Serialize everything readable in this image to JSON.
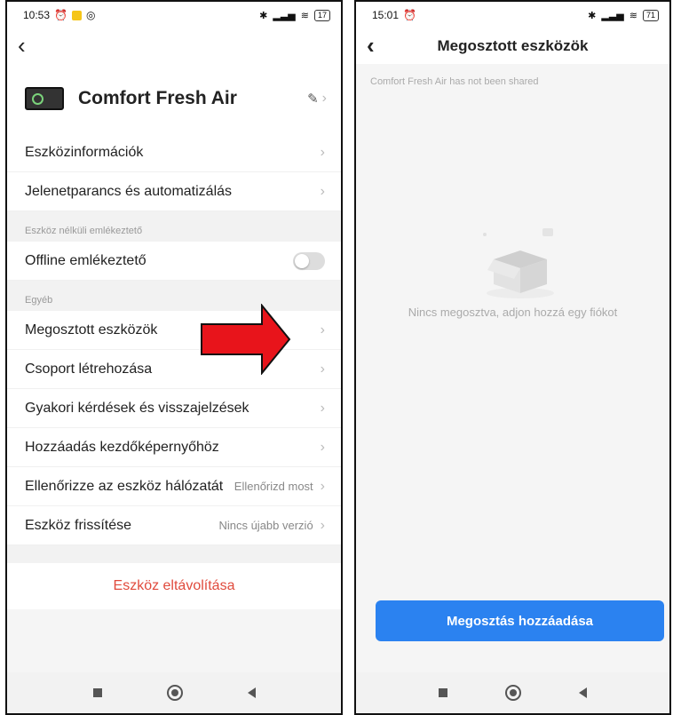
{
  "left": {
    "status": {
      "time": "10:53",
      "battery": "17"
    },
    "device_name": "Comfort  Fresh Air",
    "rows_top": [
      {
        "label": "Eszközinformációk"
      },
      {
        "label": "Jelenetparancs és automatizálás"
      }
    ],
    "section_offline": "Eszköz nélküli emlékeztető",
    "offline_label": "Offline emlékeztető",
    "offline_toggle": "off",
    "section_other": "Egyéb",
    "rows_other": [
      {
        "label": "Megosztott eszközök",
        "value": ""
      },
      {
        "label": "Csoport létrehozása",
        "value": ""
      },
      {
        "label": "Gyakori kérdések és visszajelzések",
        "value": ""
      },
      {
        "label": "Hozzáadás kezdőképernyőhöz",
        "value": ""
      },
      {
        "label": "Ellenőrizze az eszköz hálózatát",
        "value": "Ellenőrizd most"
      },
      {
        "label": "Eszköz frissítése",
        "value": "Nincs újabb verzió"
      }
    ],
    "remove_label": "Eszköz eltávolítása"
  },
  "right": {
    "status": {
      "time": "15:01",
      "battery": "71"
    },
    "title": "Megosztott eszközök",
    "not_shared": "Comfort  Fresh Air has not been shared",
    "empty_message": "Nincs megosztva, adjon hozzá egy fiókot",
    "add_button": "Megosztás hozzáadása"
  },
  "colors": {
    "accent": "#2b82f0",
    "danger": "#e04a3c",
    "arrow": "#e8141b"
  },
  "icons": [
    "back-arrow-icon",
    "edit-icon",
    "chevron-right-icon",
    "toggle-icon",
    "empty-box-icon",
    "nav-square-icon",
    "nav-home-icon",
    "nav-back-icon"
  ]
}
